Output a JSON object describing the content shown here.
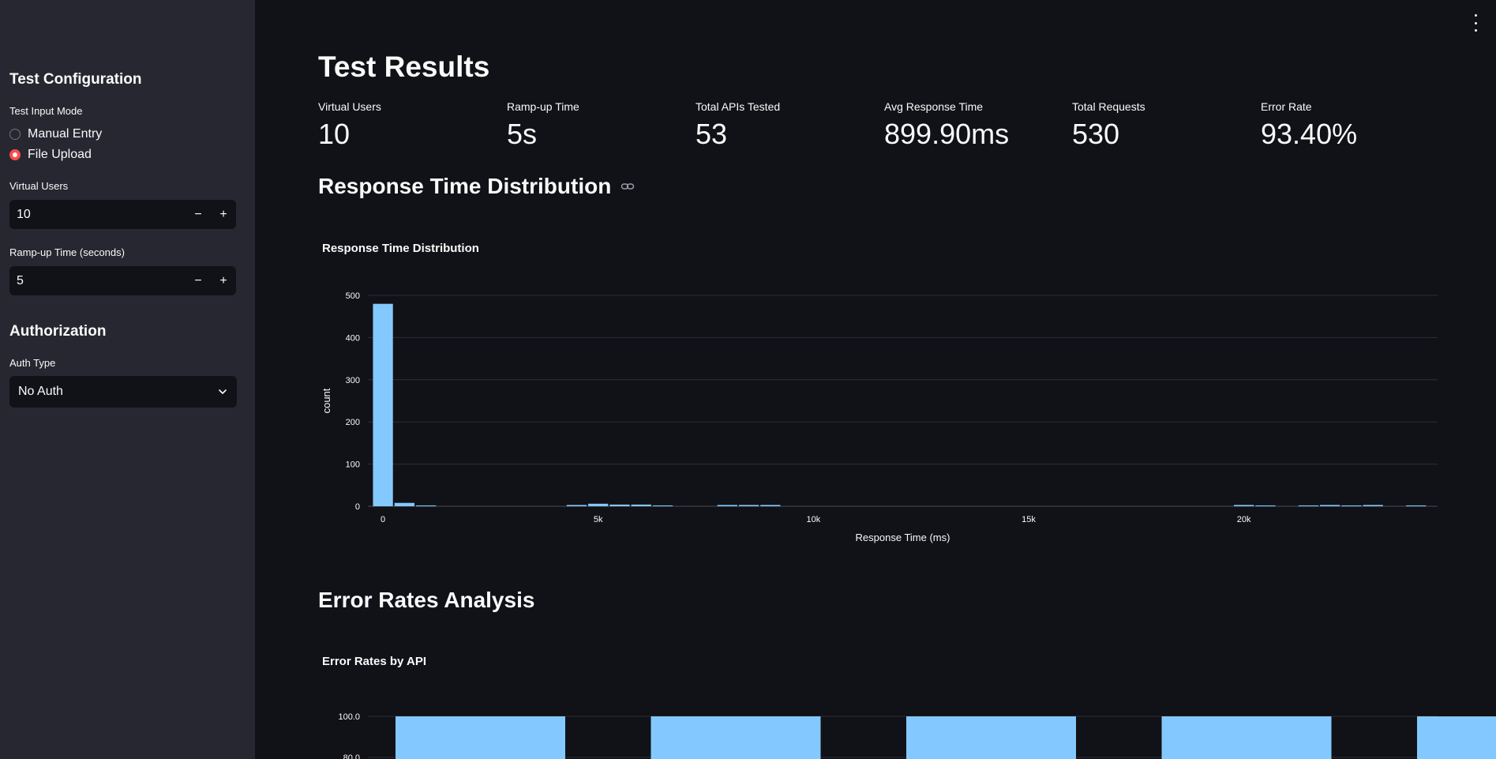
{
  "sidebar": {
    "config_title": "Test Configuration",
    "input_mode_label": "Test Input Mode",
    "input_modes": [
      "Manual Entry",
      "File Upload"
    ],
    "selected_input_mode": "File Upload",
    "virtual_users_label": "Virtual Users",
    "virtual_users_value": "10",
    "rampup_label": "Ramp-up Time (seconds)",
    "rampup_value": "5",
    "stepper_minus": "−",
    "stepper_plus": "+",
    "auth_title": "Authorization",
    "auth_type_label": "Auth Type",
    "auth_type_value": "No Auth"
  },
  "main": {
    "title": "Test Results",
    "metrics": [
      {
        "label": "Virtual Users",
        "value": "10"
      },
      {
        "label": "Ramp-up Time",
        "value": "5s"
      },
      {
        "label": "Total APIs Tested",
        "value": "53"
      },
      {
        "label": "Avg Response Time",
        "value": "899.90ms"
      },
      {
        "label": "Total Requests",
        "value": "530"
      },
      {
        "label": "Error Rate",
        "value": "93.40%"
      }
    ],
    "response_section_title": "Response Time Distribution",
    "error_section_title": "Error Rates Analysis"
  },
  "colors": {
    "accent": "#ff4b4b",
    "bar": "#83c9ff",
    "background": "#111217",
    "sidebar": "#262730"
  },
  "chart_data": [
    {
      "type": "bar",
      "title": "Response Time Distribution",
      "xlabel": "Response Time (ms)",
      "ylabel": "count",
      "xlim": [
        -350,
        24500
      ],
      "ylim": [
        0,
        500
      ],
      "xticks": [
        0,
        5000,
        10000,
        15000,
        20000
      ],
      "xtick_labels": [
        "0",
        "5k",
        "10k",
        "15k",
        "20k"
      ],
      "yticks": [
        0,
        100,
        200,
        300,
        400,
        500
      ],
      "grid": true,
      "bin_width": 500,
      "bins": [
        {
          "x0": -250,
          "count": 480
        },
        {
          "x0": 250,
          "count": 8
        },
        {
          "x0": 750,
          "count": 2
        },
        {
          "x0": 4250,
          "count": 3
        },
        {
          "x0": 4750,
          "count": 6
        },
        {
          "x0": 5250,
          "count": 4
        },
        {
          "x0": 5750,
          "count": 4
        },
        {
          "x0": 6250,
          "count": 2
        },
        {
          "x0": 7750,
          "count": 3
        },
        {
          "x0": 8250,
          "count": 3
        },
        {
          "x0": 8750,
          "count": 3
        },
        {
          "x0": 19750,
          "count": 3
        },
        {
          "x0": 20250,
          "count": 2
        },
        {
          "x0": 21250,
          "count": 2
        },
        {
          "x0": 21750,
          "count": 3
        },
        {
          "x0": 22250,
          "count": 2
        },
        {
          "x0": 22750,
          "count": 3
        },
        {
          "x0": 23750,
          "count": 2
        }
      ]
    },
    {
      "type": "bar",
      "title": "Error Rates by API",
      "yticks": [
        "100.0",
        "80.0"
      ],
      "ylim": [
        0,
        100
      ],
      "values": [
        100,
        100,
        100,
        100,
        100
      ],
      "grid": true
    }
  ]
}
